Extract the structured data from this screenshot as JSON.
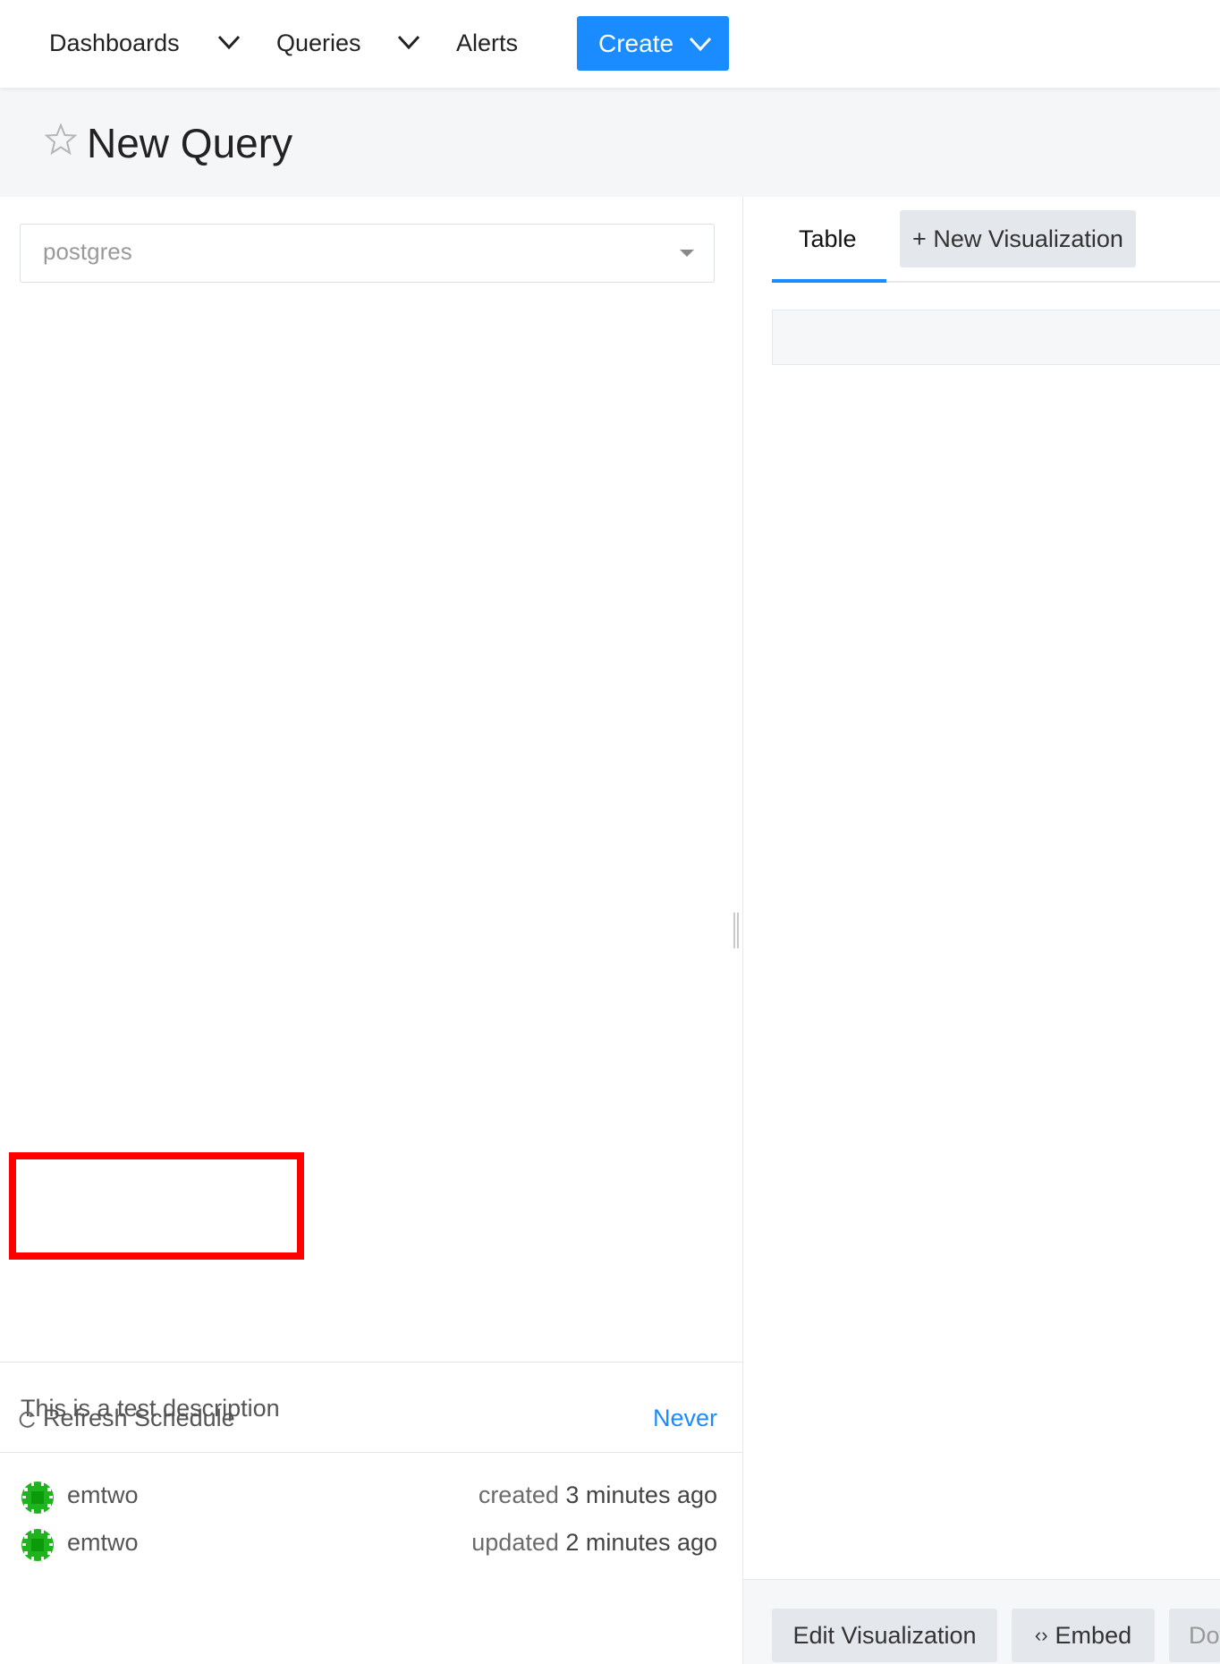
{
  "navbar": {
    "dashboards": "Dashboards",
    "queries": "Queries",
    "alerts": "Alerts",
    "create": "Create"
  },
  "header": {
    "title": "New Query"
  },
  "editor": {
    "data_source": "postgres"
  },
  "description": {
    "text": "This is a test description"
  },
  "meta": {
    "created": {
      "user": "emtwo",
      "verb": "created",
      "time": "3 minutes ago"
    },
    "updated": {
      "user": "emtwo",
      "verb": "updated",
      "time": "2 minutes ago"
    }
  },
  "schedule": {
    "label": "Refresh Schedule",
    "value": "Never"
  },
  "visualizations": {
    "tabs": [
      "Table"
    ],
    "new_label": "+ New Visualization"
  },
  "footer": {
    "edit": "Edit Visualization",
    "embed": "Embed",
    "download": "Dow"
  },
  "colors": {
    "primary": "#1a8cff",
    "highlight": "#ff0000",
    "avatar": "#1fb31f"
  }
}
